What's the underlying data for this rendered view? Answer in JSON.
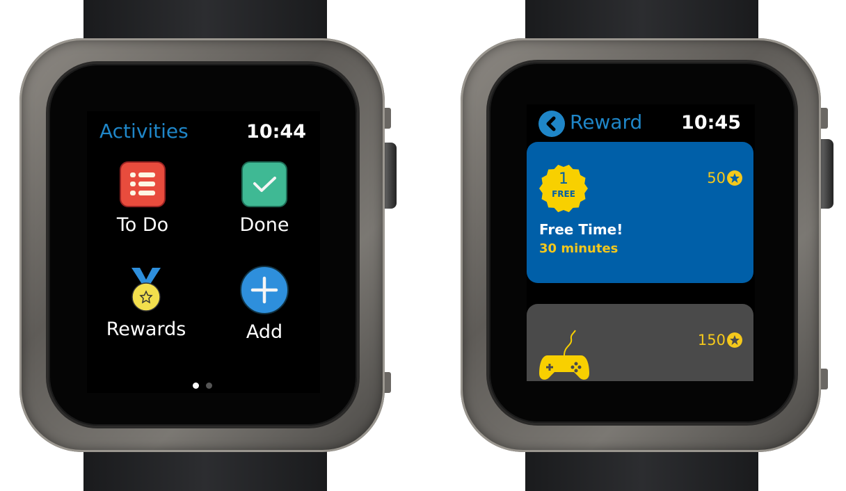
{
  "left_watch": {
    "title": "Activities",
    "time": "10:44",
    "tiles": [
      {
        "label": "To Do",
        "icon": "list-icon",
        "color": "#e84c3d"
      },
      {
        "label": "Done",
        "icon": "checkmark-icon",
        "color": "#3fb994"
      },
      {
        "label": "Rewards",
        "icon": "medal-icon",
        "color": "#f3df4d"
      },
      {
        "label": "Add",
        "icon": "plus-icon",
        "color": "#2e8fdc"
      }
    ],
    "page_count": 2,
    "current_page": 1
  },
  "right_watch": {
    "title": "Reward",
    "time": "10:45",
    "cards": [
      {
        "badge_number": "1",
        "badge_text": "FREE",
        "name": "Free Time!",
        "detail": "30 minutes",
        "points": "50",
        "color": "#005fa8"
      },
      {
        "icon": "gamepad-icon",
        "points": "150",
        "color": "#4a4a4a"
      }
    ]
  }
}
